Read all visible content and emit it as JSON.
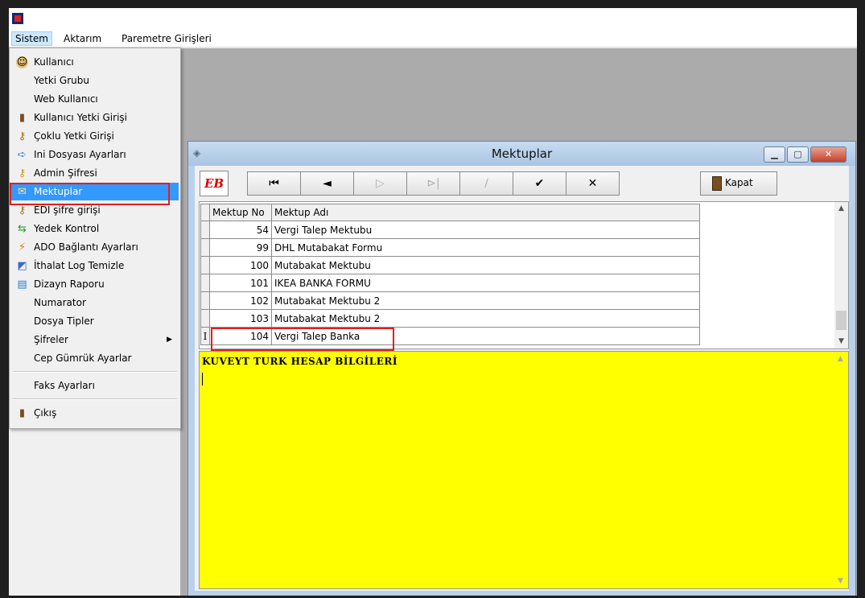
{
  "menubar": {
    "items": [
      "Sistem",
      "Aktarım",
      "Paremetre Girişleri"
    ]
  },
  "sistem_menu": {
    "items": [
      {
        "label": "Kullanıcı",
        "icon": "user-icon"
      },
      {
        "label": "Yetki Grubu",
        "icon": ""
      },
      {
        "label": "Web Kullanıcı",
        "icon": ""
      },
      {
        "label": "Kullanıcı Yetki Girişi",
        "icon": "door-icon"
      },
      {
        "label": "Çoklu Yetki Girişi",
        "icon": "key-icon"
      },
      {
        "label": "Ini Dosyası Ayarları",
        "icon": "file-arrow-icon"
      },
      {
        "label": "Admin Şifresi",
        "icon": "key-icon"
      },
      {
        "label": "Mektuplar",
        "icon": "envelope-icon",
        "selected": true
      },
      {
        "label": "EDI şifre girişi",
        "icon": "key-icon"
      },
      {
        "label": "Yedek Kontrol",
        "icon": "backup-icon"
      },
      {
        "label": "ADO Bağlantı Ayarları",
        "icon": "connection-icon"
      },
      {
        "label": "İthalat Log Temizle",
        "icon": "clean-icon"
      },
      {
        "label": "Dizayn Raporu",
        "icon": "report-icon"
      },
      {
        "label": "Numarator",
        "icon": ""
      },
      {
        "label": "Dosya Tipler",
        "icon": ""
      },
      {
        "label": "Şifreler",
        "icon": "",
        "submenu": true
      },
      {
        "label": "Cep Gümrük Ayarlar",
        "icon": ""
      }
    ],
    "after_sep_1": {
      "label": "Faks Ayarları"
    },
    "after_sep_2": {
      "label": "Çıkış",
      "icon": "door-icon"
    }
  },
  "mektuplar_window": {
    "title": "Mektuplar",
    "logo_text": "EB",
    "nav_buttons": [
      {
        "symbol": "⏮",
        "name": "first-record-button",
        "disabled": false
      },
      {
        "symbol": "◄",
        "name": "prior-record-button",
        "disabled": false
      },
      {
        "symbol": "▷",
        "name": "next-record-button",
        "disabled": true
      },
      {
        "symbol": "⊳|",
        "name": "last-record-button",
        "disabled": true
      },
      {
        "symbol": "∕",
        "name": "edit-record-button",
        "disabled": true
      },
      {
        "symbol": "✔",
        "name": "post-record-button",
        "disabled": false
      },
      {
        "symbol": "✕",
        "name": "cancel-record-button",
        "disabled": false
      }
    ],
    "kapat_label": "Kapat",
    "grid": {
      "columns": [
        "Mektup No",
        "Mektup Adı"
      ],
      "rows": [
        {
          "no": "54",
          "name": "Vergi Talep Mektubu"
        },
        {
          "no": "99",
          "name": "DHL Mutabakat Formu"
        },
        {
          "no": "100",
          "name": "Mutabakat Mektubu"
        },
        {
          "no": "101",
          "name": "IKEA BANKA  FORMU"
        },
        {
          "no": "102",
          "name": "Mutabakat Mektubu 2"
        },
        {
          "no": "103",
          "name": "Mutabakat Mektubu 2"
        },
        {
          "no": "104",
          "name": "Vergi Talep Banka",
          "current": true,
          "indicator": "I"
        }
      ]
    },
    "memo_text": "KUVEYT TURK  HESAP BİLGİLERİ",
    "highlight_color": "#e01f1f",
    "memo_color": "#ffff00"
  }
}
